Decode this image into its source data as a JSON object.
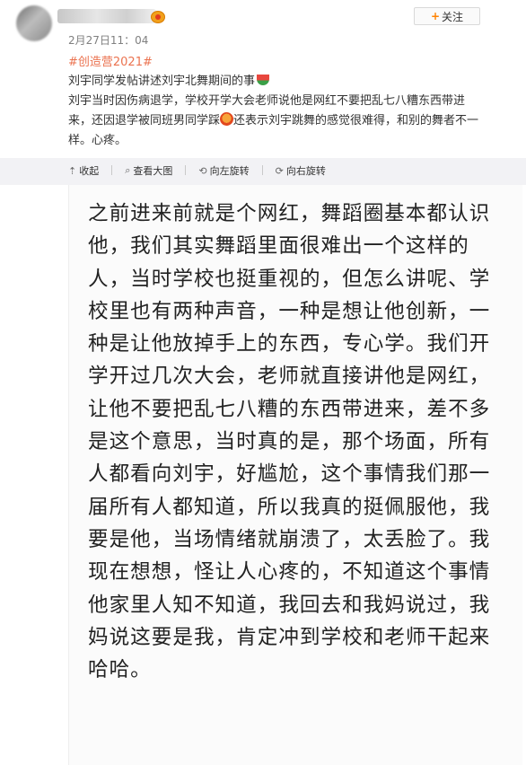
{
  "post": {
    "time": "2月27日11：04",
    "follow_label": "关注",
    "topic": "#创造营2021#",
    "headline": "刘宇同学发帖讲述刘宇北舞期间的事",
    "body_lines": [
      "刘宇当时因伤病退学，学校开学大会老师说他是网红不要把乱七八糟东西带进",
      "来，还因退学被同班男同学踩",
      "还表示刘宇跳舞的感觉很难得，和别的舞者不一",
      "样。心疼。"
    ]
  },
  "toolbar": {
    "collapse_label": "收起",
    "view_large_label": "查看大图",
    "rotate_left_label": "向左旋转",
    "rotate_right_label": "向右旋转"
  },
  "image_text_lines": [
    "之前进来前就是个网红，舞蹈圈基本都认识",
    "他，我们其实舞蹈里面很难出一个这样的",
    "人，当时学校也挺重视的，但怎么讲呢、学",
    "校里也有两种声音，一种是想让他创新，一",
    "种是让他放掉手上的东西，专心学。我们开",
    "学开过几次大会，老师就直接讲他是网红，",
    "让他不要把乱七八糟的东西带进来，差不多",
    "是这个意思，当时真的是，那个场面，所有",
    "人都看向刘宇，好尴尬，这个事情我们那一",
    "届所有人都知道，所以我真的挺佩服他，我",
    "要是他，当场情绪就崩溃了，太丢脸了。我",
    "现在想想，怪让人心疼的，不知道这个事情",
    "他家里人知不知道，我回去和我妈说过，我",
    "妈说这要是我，肯定冲到学校和老师干起来",
    "哈哈。"
  ]
}
